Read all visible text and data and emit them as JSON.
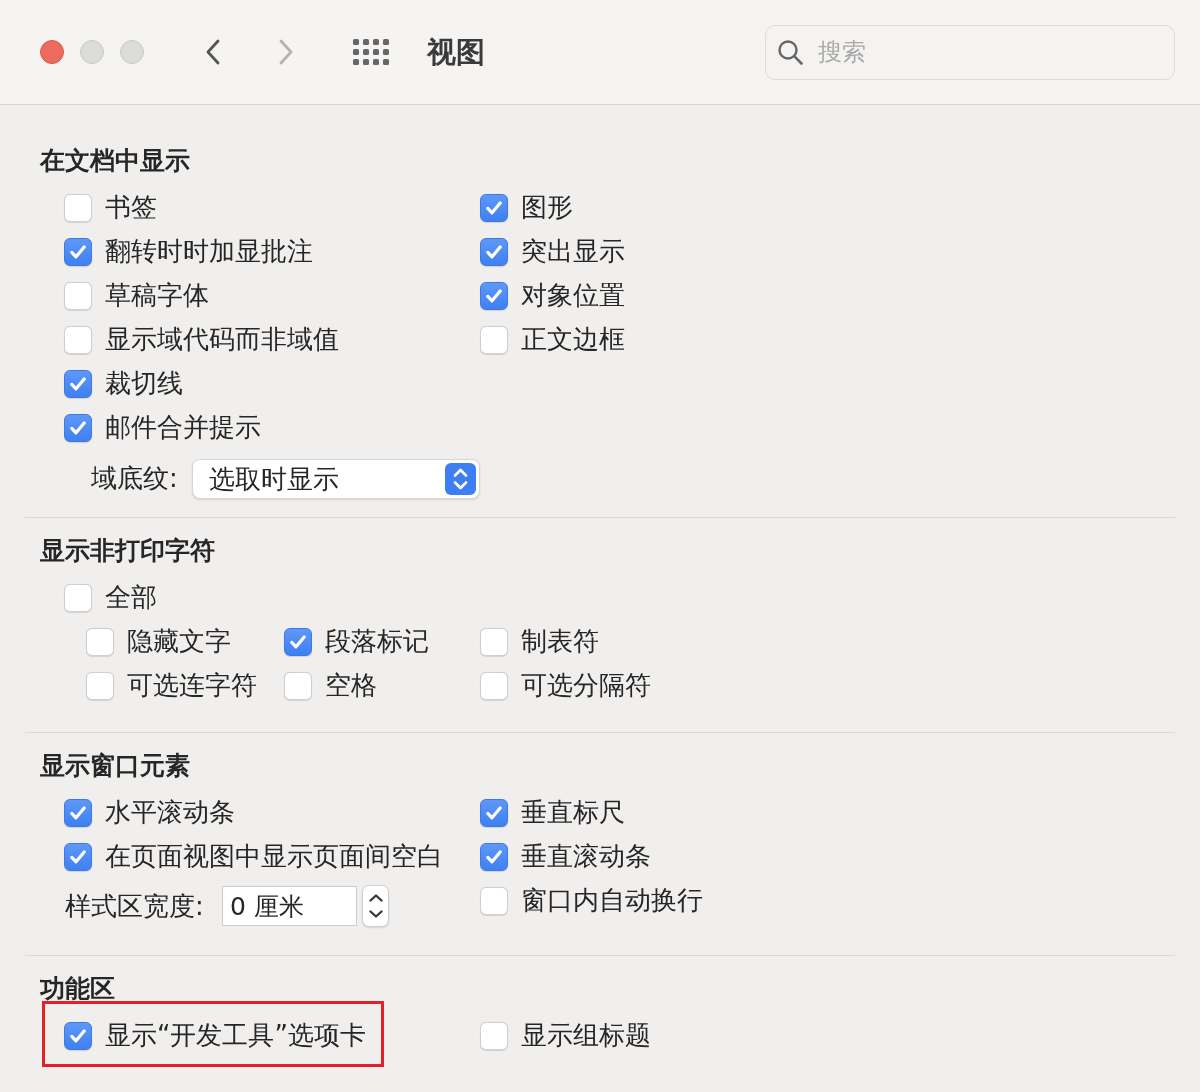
{
  "window": {
    "buttons": [
      {
        "kind": "close",
        "disabled": false
      },
      {
        "kind": "minimize",
        "disabled": true
      },
      {
        "kind": "zoom",
        "disabled": true
      }
    ]
  },
  "toolbar": {
    "nav": [
      {
        "kind": "back",
        "disabled": false
      },
      {
        "kind": "forward",
        "disabled": true
      }
    ],
    "title": "视图",
    "search": {
      "placeholder": "搜索"
    }
  },
  "sections": [
    {
      "kind": "columns",
      "title": "在文档中显示",
      "columns": [
        [
          {
            "kind": "checkbox",
            "label": "书签",
            "checked": false
          },
          {
            "kind": "checkbox",
            "label": "翻转时时加显批注",
            "checked": true
          },
          {
            "kind": "checkbox",
            "label": "草稿字体",
            "checked": false
          },
          {
            "kind": "checkbox",
            "label": "显示域代码而非域值",
            "checked": false
          },
          {
            "kind": "checkbox",
            "label": "裁切线",
            "checked": true
          },
          {
            "kind": "checkbox",
            "label": "邮件合并提示",
            "checked": true
          },
          {
            "kind": "popup",
            "label": "域底纹:",
            "value": "选取时显示"
          }
        ],
        [
          {
            "kind": "checkbox",
            "label": "图形",
            "checked": true
          },
          {
            "kind": "checkbox",
            "label": "突出显示",
            "checked": true
          },
          {
            "kind": "checkbox",
            "label": "对象位置",
            "checked": true
          },
          {
            "kind": "checkbox",
            "label": "正文边框",
            "checked": false
          }
        ]
      ]
    },
    {
      "kind": "nested",
      "title": "显示非打印字符",
      "master": {
        "label": "全部",
        "checked": false
      },
      "options": [
        {
          "label": "隐藏文字",
          "checked": false
        },
        {
          "label": "段落标记",
          "checked": true
        },
        {
          "label": "制表符",
          "checked": false
        },
        {
          "label": "可选连字符",
          "checked": false
        },
        {
          "label": "空格",
          "checked": false
        },
        {
          "label": "可选分隔符",
          "checked": false
        }
      ]
    },
    {
      "kind": "columns",
      "title": "显示窗口元素",
      "columns": [
        [
          {
            "kind": "checkbox",
            "label": "水平滚动条",
            "checked": true
          },
          {
            "kind": "checkbox",
            "label": "在页面视图中显示页面间空白",
            "checked": true
          },
          {
            "kind": "stepper",
            "label": "样式区宽度:",
            "value": "0 厘米"
          }
        ],
        [
          {
            "kind": "checkbox",
            "label": "垂直标尺",
            "checked": true
          },
          {
            "kind": "checkbox",
            "label": "垂直滚动条",
            "checked": true
          },
          {
            "kind": "checkbox",
            "label": "窗口内自动换行",
            "checked": false
          }
        ]
      ]
    },
    {
      "kind": "columns",
      "title": "功能区",
      "columns": [
        [
          {
            "kind": "checkbox",
            "label": "显示“开发工具”选项卡",
            "checked": true,
            "highlighted": true
          }
        ],
        [
          {
            "kind": "checkbox",
            "label": "显示组标题",
            "checked": false,
            "highlighted": false
          }
        ]
      ]
    }
  ]
}
